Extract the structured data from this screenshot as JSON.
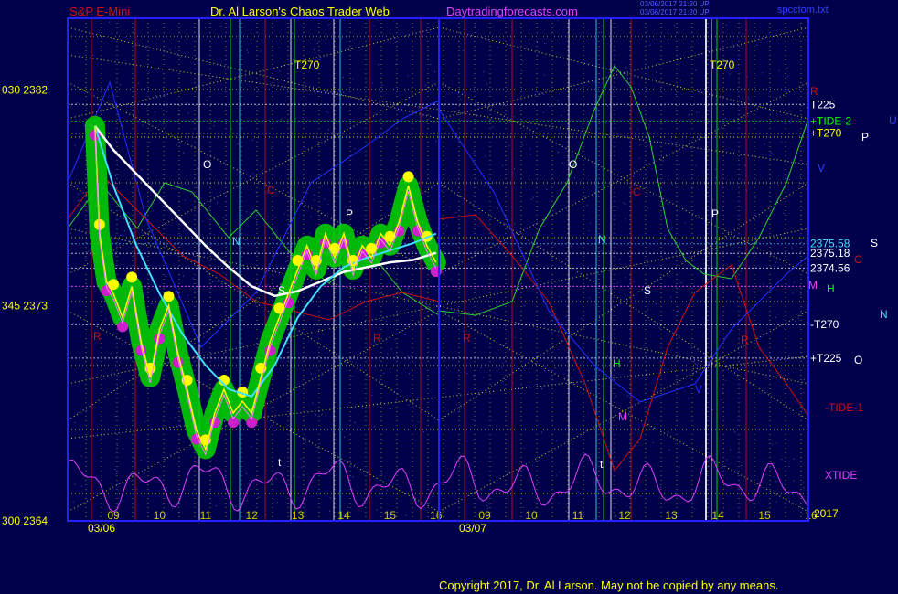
{
  "header": {
    "symbol": "S&P E-Mini",
    "author": "Dr. Al Larson's Chaos Trader Web",
    "site": "Daytradingforecasts.com",
    "timestamp_line1": "03/06/2017 21:20 UP",
    "timestamp_line2": "03/06/2017 21:20 UP",
    "file": "spcctom.txt"
  },
  "copyright": "Copyright 2017, Dr. Al Larson. May not be copied by any means.",
  "colors": {
    "background": "#00004a",
    "frame": "#2222ff",
    "price": "#ffff00",
    "tide": "#00d000",
    "xtide": "#e040ff",
    "fast_ma": "#40e0ff",
    "slow_ma": "#ffffff",
    "grid": "#cccc33",
    "red_lines": "#d01010"
  },
  "chart_data": {
    "type": "line",
    "title": "S&P E-Mini",
    "xlabel": "",
    "ylabel": "",
    "ylim": [
      2364,
      2385
    ],
    "y_ticks": [
      {
        "value": 2382,
        "label": "030  2382"
      },
      {
        "value": 2373,
        "label": "345  2373"
      },
      {
        "value": 2364,
        "label": "300  2364"
      }
    ],
    "x_ticks_day1": [
      "09",
      "10",
      "11",
      "12",
      "13",
      "14",
      "15",
      "16"
    ],
    "x_ticks_day2": [
      "09",
      "10",
      "11",
      "12",
      "13",
      "14",
      "15",
      "16"
    ],
    "dates": [
      "03/06",
      "03/07"
    ],
    "year_label": "2017",
    "price_series": {
      "name": "S&P E-Mini",
      "x": [
        8.6,
        8.7,
        8.85,
        9.0,
        9.2,
        9.4,
        9.6,
        9.8,
        10.0,
        10.2,
        10.4,
        10.6,
        10.8,
        11.0,
        11.2,
        11.4,
        11.6,
        11.8,
        12.0,
        12.2,
        12.4,
        12.6,
        12.8,
        13.0,
        13.2,
        13.4,
        13.6,
        13.8,
        14.0,
        14.2,
        14.4,
        14.6,
        14.8,
        15.0,
        15.2,
        15.4,
        15.6,
        15.8,
        16.0
      ],
      "values": [
        2380.5,
        2376.0,
        2374.0,
        2373.5,
        2372.5,
        2373.8,
        2371.5,
        2370.0,
        2372.0,
        2373.0,
        2371.0,
        2369.5,
        2367.8,
        2367.0,
        2368.5,
        2369.5,
        2368.5,
        2369.0,
        2368.5,
        2370.0,
        2371.5,
        2372.5,
        2373.5,
        2374.5,
        2375.5,
        2374.5,
        2376.0,
        2375.0,
        2376.0,
        2374.5,
        2375.5,
        2375.0,
        2376.0,
        2375.5,
        2376.5,
        2378.0,
        2376.5,
        2375.5,
        2374.8
      ]
    },
    "slow_ma": {
      "name": "slow average",
      "x": [
        8.6,
        9.0,
        9.5,
        10.0,
        10.5,
        11.0,
        11.5,
        12.0,
        12.5,
        13.0,
        13.5,
        14.0,
        14.5,
        15.0,
        15.5,
        16.0
      ],
      "values": [
        2380.5,
        2379.5,
        2378.5,
        2377.5,
        2376.5,
        2375.5,
        2374.6,
        2373.8,
        2373.4,
        2373.6,
        2374.0,
        2374.4,
        2374.6,
        2374.8,
        2374.9,
        2375.2
      ]
    },
    "fast_ma": {
      "name": "fast average",
      "x": [
        8.6,
        9.0,
        9.5,
        10.0,
        10.5,
        11.0,
        11.5,
        12.0,
        12.5,
        13.0,
        13.5,
        14.0,
        14.5,
        15.0,
        15.5,
        16.0
      ],
      "values": [
        2380.5,
        2378.0,
        2375.5,
        2373.5,
        2371.8,
        2370.5,
        2369.5,
        2369.2,
        2370.5,
        2372.5,
        2373.8,
        2374.6,
        2375.0,
        2375.3,
        2375.6,
        2376.0
      ]
    },
    "levels": [
      {
        "label": "T225",
        "value": 2381.4,
        "color": "#ffffff"
      },
      {
        "label": "+TIDE-2",
        "value": 2380.7,
        "color": "#00ff00"
      },
      {
        "label": "+T270",
        "value": 2380.2,
        "color": "#ffff00"
      },
      {
        "label": "2375.58",
        "value": 2375.58,
        "color": "#40e0ff"
      },
      {
        "label": "2375.18",
        "value": 2375.18,
        "color": "#ffffff"
      },
      {
        "label": "2374.56",
        "value": 2374.56,
        "color": "#ffffff"
      },
      {
        "label": "-T270",
        "value": 2372.2,
        "color": "#ffffff"
      },
      {
        "label": "+T225",
        "value": 2370.8,
        "color": "#ffffff"
      }
    ],
    "right_labels": [
      {
        "text": "R",
        "color": "#d01010"
      },
      {
        "text": "U",
        "color": "#3040ff"
      },
      {
        "text": "P",
        "color": "#ffffff"
      },
      {
        "text": "V",
        "color": "#3040ff"
      },
      {
        "text": "S",
        "color": "#ffffff"
      },
      {
        "text": "C",
        "color": "#d01010"
      },
      {
        "text": "M",
        "color": "#e040ff"
      },
      {
        "text": "H",
        "color": "#00ff00"
      },
      {
        "text": "N",
        "color": "#40e0ff"
      },
      {
        "text": "O",
        "color": "#ffffff"
      },
      {
        "text": "-TIDE-1",
        "color": "#d01010"
      },
      {
        "text": "XTIDE",
        "color": "#e040ff"
      }
    ],
    "in_chart_labels": [
      "T270",
      "T270",
      "O",
      "O",
      "N",
      "N",
      "P",
      "P",
      "C",
      "C",
      "R",
      "R",
      "R",
      "R",
      "S",
      "S",
      "M",
      "V",
      "H",
      "t",
      "t"
    ]
  }
}
